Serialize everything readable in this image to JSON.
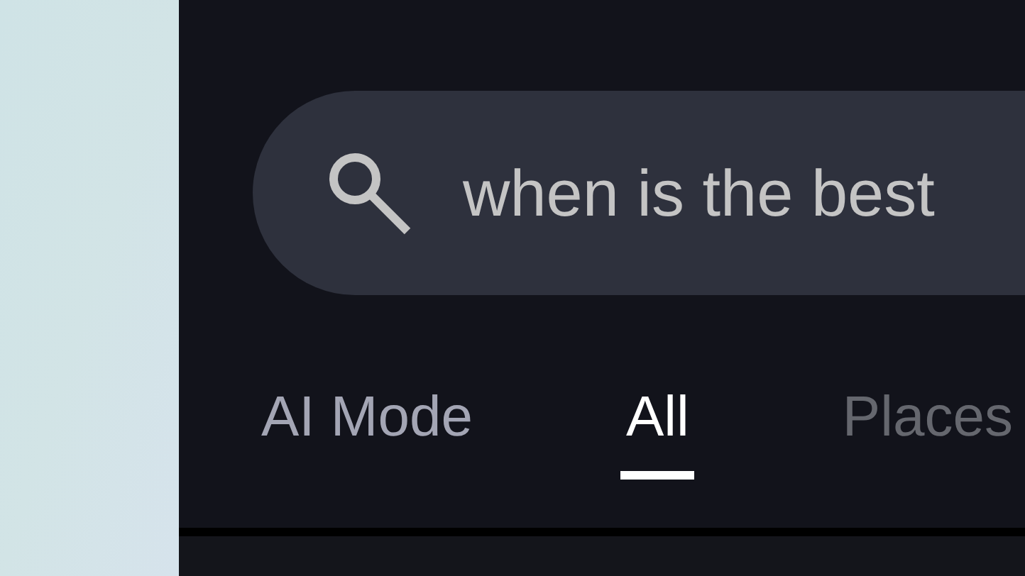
{
  "search": {
    "value": "when is the best"
  },
  "tabs": [
    {
      "label": "AI Mode",
      "kind": "mode",
      "selected": false
    },
    {
      "label": "All",
      "kind": "tab",
      "selected": true
    },
    {
      "label": "Places",
      "kind": "tab",
      "selected": false
    }
  ]
}
